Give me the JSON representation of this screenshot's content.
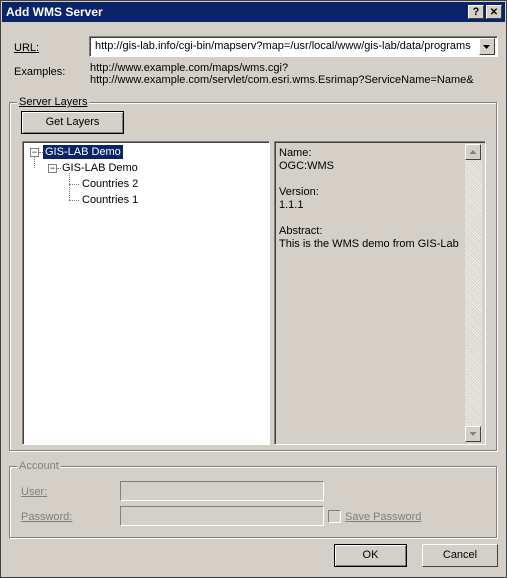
{
  "window": {
    "title": "Add WMS Server",
    "help_glyph": "?",
    "close_glyph": "✕"
  },
  "url": {
    "label": "URL:",
    "value": "http://gis-lab.info/cgi-bin/mapserv?map=/usr/local/www/gis-lab/data/programs",
    "examples_label": "Examples:",
    "examples": [
      "http://www.example.com/maps/wms.cgi?",
      "http://www.example.com/servlet/com.esri.wms.Esrimap?ServiceName=Name&"
    ]
  },
  "server_layers": {
    "legend": "Server Layers",
    "get_layers_label": "Get Layers",
    "tree": {
      "root": "GIS-LAB Demo",
      "child": "GIS-LAB Demo",
      "leaves": [
        "Countries 2",
        "Countries 1"
      ]
    },
    "info": {
      "lines": [
        "Name:",
        "OGC:WMS",
        "",
        "Version:",
        "1.1.1",
        "",
        "Abstract:",
        "This is the WMS demo from GIS-Lab"
      ]
    }
  },
  "account": {
    "legend": "Account",
    "user_label": "User:",
    "password_label": "Password:",
    "save_password_label": "Save Password",
    "user_value": "",
    "password_value": "",
    "save_password_checked": false
  },
  "buttons": {
    "ok": "OK",
    "cancel": "Cancel"
  },
  "icons": {
    "dropdown": "chevron-down-icon",
    "scroll_up": "arrow-up-icon",
    "scroll_down": "arrow-down-icon",
    "tree_collapse": "minus-box-icon"
  },
  "colors": {
    "titlebar": "#0a246a",
    "selection": "#0a246a",
    "face": "#d4d0c8"
  }
}
